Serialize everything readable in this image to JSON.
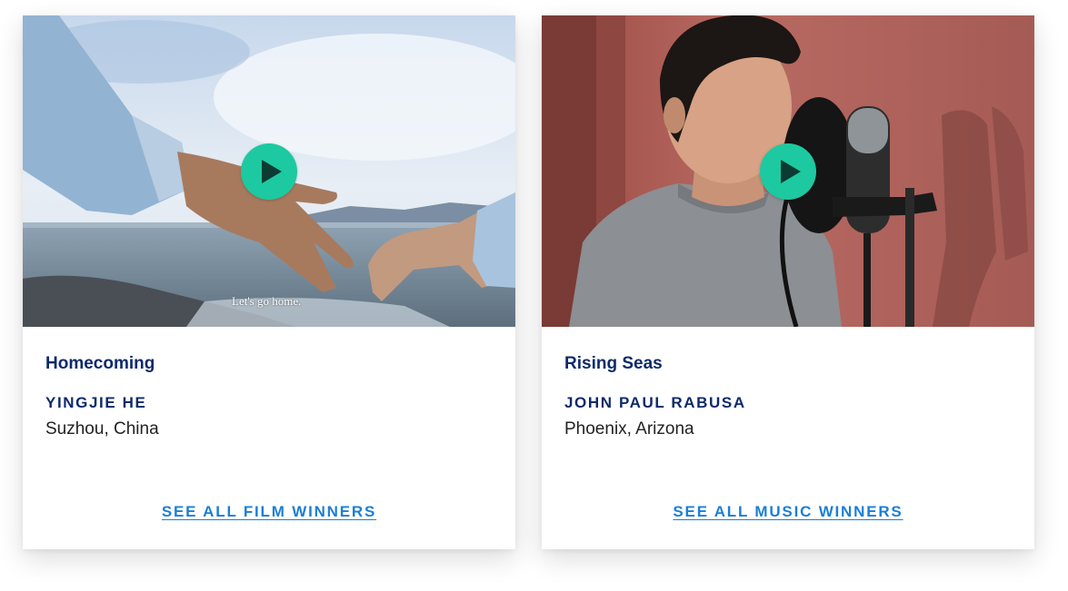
{
  "cards": [
    {
      "title": "Homecoming",
      "artist": "YINGJIE HE",
      "location": "Suzhou, China",
      "link": "SEE ALL FILM WINNERS",
      "subtitle": "Let's go home."
    },
    {
      "title": "Rising Seas",
      "artist": "JOHN PAUL RABUSA",
      "location": "Phoenix, Arizona",
      "link": "SEE ALL MUSIC WINNERS"
    }
  ],
  "colors": {
    "play_button": "#1dc9a0",
    "title_text": "#0d2a6b",
    "link": "#1a7fd6"
  }
}
